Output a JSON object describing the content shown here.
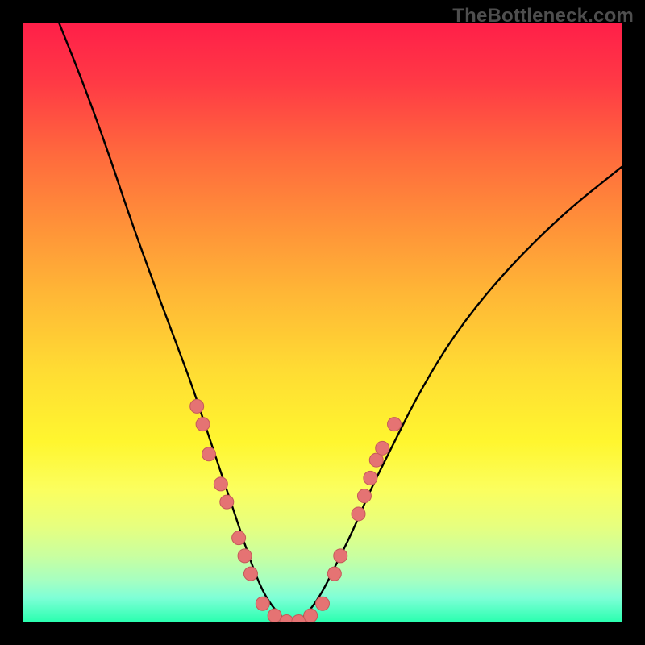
{
  "watermark": "TheBottleneck.com",
  "colors": {
    "background": "#000000",
    "gradient_top": "#ff1f49",
    "gradient_bottom": "#2bffb0",
    "curve": "#000000",
    "dot_fill": "#e57373",
    "dot_stroke": "#c55a5a"
  },
  "chart_data": {
    "type": "line",
    "title": "",
    "xlabel": "",
    "ylabel": "",
    "xlim": [
      0,
      100
    ],
    "ylim": [
      0,
      100
    ],
    "grid": false,
    "legend": false,
    "annotations": [
      "TheBottleneck.com"
    ],
    "series": [
      {
        "name": "left-branch",
        "x": [
          6,
          10,
          14,
          18,
          22,
          25,
          28,
          30,
          32,
          34,
          36,
          38,
          40,
          42,
          44
        ],
        "y": [
          100,
          90,
          79,
          67,
          56,
          48,
          40,
          34,
          28,
          22,
          16,
          10,
          5,
          2,
          0
        ]
      },
      {
        "name": "right-branch",
        "x": [
          44,
          46,
          48,
          50,
          52,
          55,
          58,
          62,
          66,
          72,
          80,
          90,
          100
        ],
        "y": [
          0,
          0,
          2,
          5,
          9,
          15,
          22,
          30,
          38,
          48,
          58,
          68,
          76
        ]
      }
    ],
    "points": [
      {
        "name": "left-cluster-upper",
        "x": 29,
        "y": 36
      },
      {
        "name": "left-cluster-upper",
        "x": 30,
        "y": 33
      },
      {
        "name": "left-cluster-upper",
        "x": 31,
        "y": 28
      },
      {
        "name": "left-cluster-lower",
        "x": 33,
        "y": 23
      },
      {
        "name": "left-cluster-lower",
        "x": 34,
        "y": 20
      },
      {
        "name": "left-cluster-lower",
        "x": 36,
        "y": 14
      },
      {
        "name": "left-cluster-lower",
        "x": 37,
        "y": 11
      },
      {
        "name": "left-cluster-lower",
        "x": 38,
        "y": 8
      },
      {
        "name": "trough",
        "x": 40,
        "y": 3
      },
      {
        "name": "trough",
        "x": 42,
        "y": 1
      },
      {
        "name": "trough",
        "x": 44,
        "y": 0
      },
      {
        "name": "trough",
        "x": 46,
        "y": 0
      },
      {
        "name": "trough",
        "x": 48,
        "y": 1
      },
      {
        "name": "trough",
        "x": 50,
        "y": 3
      },
      {
        "name": "right-cluster-lower",
        "x": 52,
        "y": 8
      },
      {
        "name": "right-cluster-lower",
        "x": 53,
        "y": 11
      },
      {
        "name": "right-cluster-upper",
        "x": 56,
        "y": 18
      },
      {
        "name": "right-cluster-upper",
        "x": 57,
        "y": 21
      },
      {
        "name": "right-cluster-upper",
        "x": 58,
        "y": 24
      },
      {
        "name": "right-cluster-upper",
        "x": 59,
        "y": 27
      },
      {
        "name": "right-cluster-upper",
        "x": 60,
        "y": 29
      },
      {
        "name": "right-cluster-upper",
        "x": 62,
        "y": 33
      }
    ]
  }
}
